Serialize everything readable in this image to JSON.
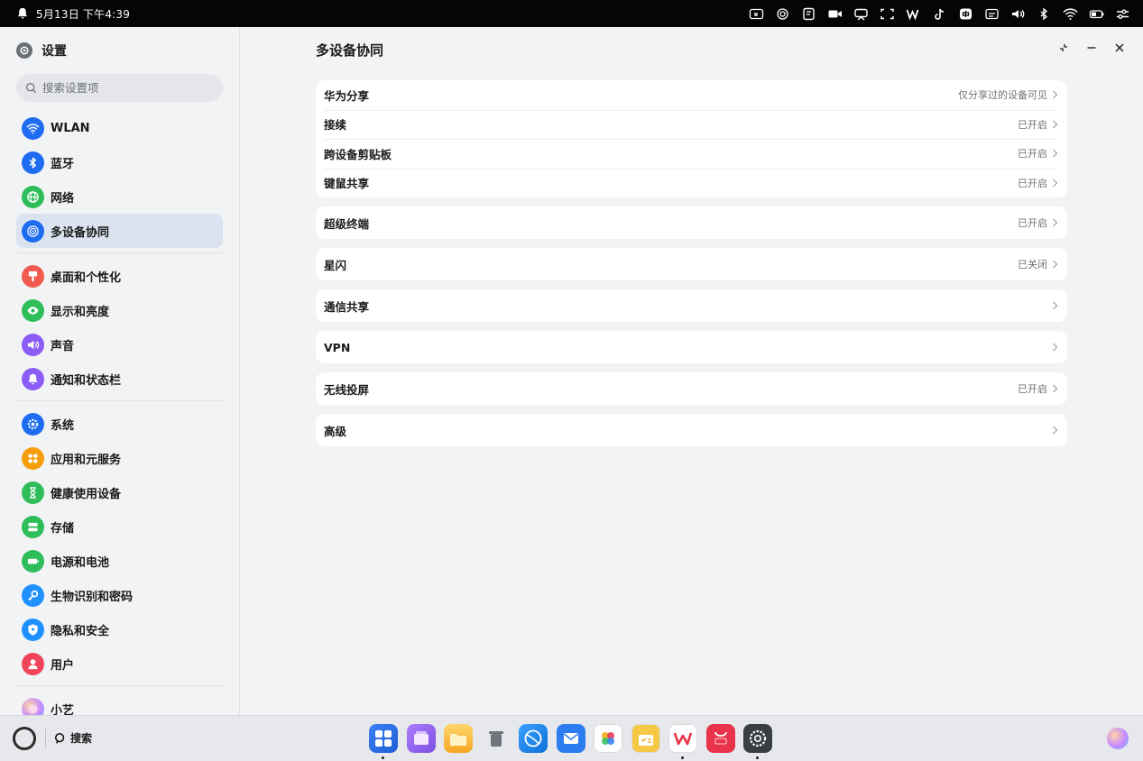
{
  "status_bar": {
    "time": "5月13日 下午4:39",
    "icons": [
      "screen-share-icon",
      "multi-device-icon",
      "note-icon",
      "video-icon",
      "cast-icon",
      "screenshot-icon",
      "wps-icon",
      "tiktok-icon",
      "input-method-icon",
      "subtitle-icon",
      "volume-icon",
      "bluetooth-icon",
      "wifi-icon",
      "battery-icon",
      "controls-icon"
    ]
  },
  "sidebar": {
    "app_title": "设置",
    "search_placeholder": "搜索设置项",
    "groups": [
      [
        {
          "label": "WLAN",
          "icon": "wifi-icon",
          "color": "#1e6cf0"
        },
        {
          "label": "蓝牙",
          "icon": "bluetooth-icon",
          "color": "#1e6cf0"
        },
        {
          "label": "网络",
          "icon": "network-icon",
          "color": "#2fbd5a"
        },
        {
          "label": "多设备协同",
          "icon": "multi-device-icon",
          "color": "#1e6cf0",
          "active": true
        }
      ],
      [
        {
          "label": "桌面和个性化",
          "icon": "brush-icon",
          "color": "#f05a4f"
        },
        {
          "label": "显示和亮度",
          "icon": "eye-icon",
          "color": "#2fbd5a"
        },
        {
          "label": "声音",
          "icon": "speaker-icon",
          "color": "#8b5cf6"
        },
        {
          "label": "通知和状态栏",
          "icon": "bell-icon",
          "color": "#8b5cf6"
        }
      ],
      [
        {
          "label": "系统",
          "icon": "gear-icon",
          "color": "#1e6cf0"
        },
        {
          "label": "应用和元服务",
          "icon": "apps-icon",
          "color": "#f59e0b"
        },
        {
          "label": "健康使用设备",
          "icon": "hourglass-icon",
          "color": "#2fbd5a"
        },
        {
          "label": "存储",
          "icon": "storage-icon",
          "color": "#2fbd5a"
        },
        {
          "label": "电源和电池",
          "icon": "battery-icon",
          "color": "#2fbd5a"
        },
        {
          "label": "生物识别和密码",
          "icon": "key-icon",
          "color": "#1e90ff"
        },
        {
          "label": "隐私和安全",
          "icon": "shield-icon",
          "color": "#1e90ff"
        },
        {
          "label": "用户",
          "icon": "user-icon",
          "color": "#f0445a"
        }
      ],
      [
        {
          "label": "小艺",
          "icon": "celia-icon",
          "color": "#c78cff"
        }
      ]
    ]
  },
  "main": {
    "title": "多设备协同",
    "groups": [
      [
        {
          "label": "华为分享",
          "value": "仅分享过的设备可见"
        },
        {
          "label": "接续",
          "value": "已开启"
        },
        {
          "label": "跨设备剪贴板",
          "value": "已开启"
        },
        {
          "label": "键鼠共享",
          "value": "已开启"
        }
      ],
      [
        {
          "label": "超级终端",
          "value": "已开启"
        }
      ],
      [
        {
          "label": "星闪",
          "value": "已关闭"
        }
      ],
      [
        {
          "label": "通信共享",
          "value": ""
        }
      ],
      [
        {
          "label": "VPN",
          "value": ""
        }
      ],
      [
        {
          "label": "无线投屏",
          "value": "已开启"
        }
      ],
      [
        {
          "label": "高级",
          "value": ""
        }
      ]
    ]
  },
  "taskbar": {
    "search_label": "搜索",
    "dock": [
      {
        "name": "app-center",
        "color": "#2f6de6",
        "running": true
      },
      {
        "name": "multitask",
        "color": "#8e5be0",
        "running": false
      },
      {
        "name": "files",
        "color": "#f5b82e",
        "running": false
      },
      {
        "name": "trash",
        "color": "#9aa0a6",
        "running": false
      },
      {
        "name": "browser",
        "color": "#1e88e5",
        "running": false
      },
      {
        "name": "mail",
        "color": "#2d7cf0",
        "running": false
      },
      {
        "name": "gallery",
        "color": "#ffffff",
        "running": false
      },
      {
        "name": "notes",
        "color": "#f6c944",
        "running": false
      },
      {
        "name": "wps",
        "color": "#ffffff",
        "running": true
      },
      {
        "name": "app-gallery",
        "color": "#e8334a",
        "running": false
      },
      {
        "name": "settings",
        "color": "#3a3d42",
        "running": true
      }
    ]
  }
}
